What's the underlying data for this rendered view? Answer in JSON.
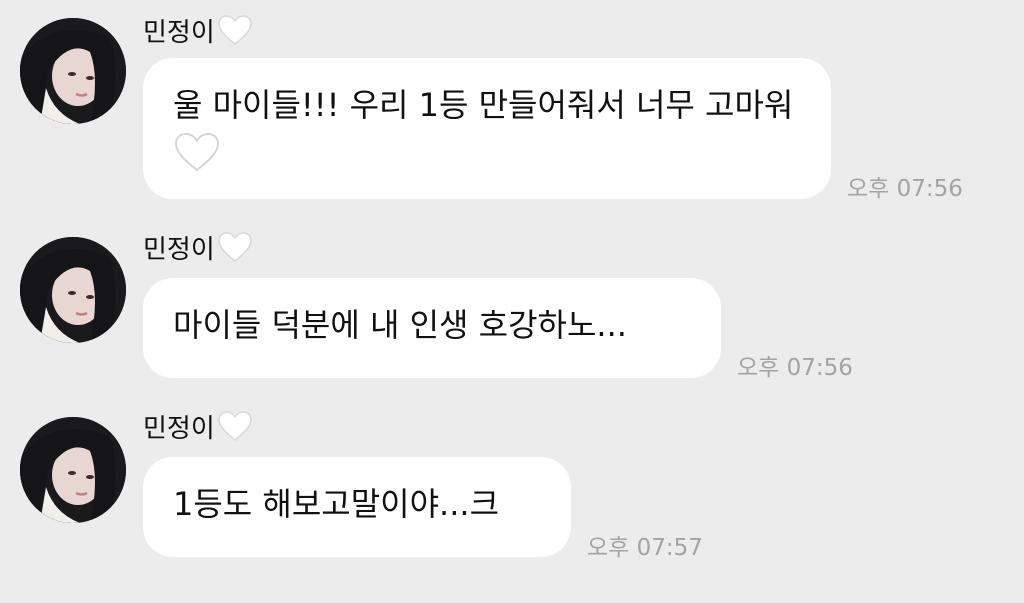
{
  "messages": [
    {
      "sender": "민정이",
      "text": "울 마이들!!! 우리 1등 만들어줘서 너무 고마워",
      "time": "오후 07:56"
    },
    {
      "sender": "민정이",
      "text": "마이들 덕분에 내 인생 호강하노...",
      "time": "오후 07:56"
    },
    {
      "sender": "민정이",
      "text": "1등도 해보고말이야...크",
      "time": "오후 07:57"
    }
  ],
  "icons": {
    "sender_suffix": "white-heart-icon",
    "avatar": "profile-photo"
  },
  "colors": {
    "background": "#ececec",
    "bubble": "#ffffff",
    "time": "#a3a3a3"
  }
}
